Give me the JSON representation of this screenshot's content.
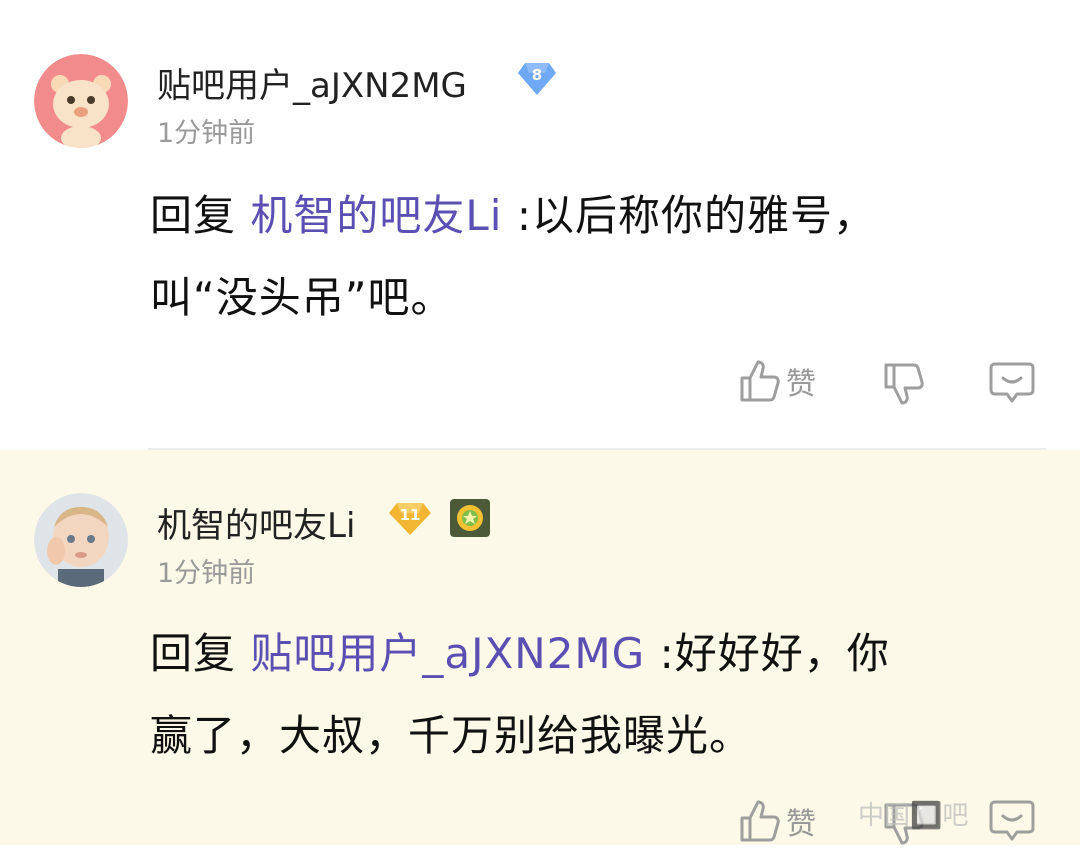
{
  "posts": [
    {
      "username": "贴吧用户_aJXN2MG",
      "level": "8",
      "time": "1分钟前",
      "reply_prefix": "回复",
      "reply_to": "机智的吧友Li",
      "text_line1": ":以后称你的雅号，",
      "text_line2": "叫“没头吊”吧。",
      "like_label": "赞",
      "icons": {
        "like": "thumbs-up-icon",
        "dislike": "thumbs-down-icon",
        "reply": "comment-icon",
        "level": "diamond-badge-icon"
      },
      "level_color": "#6fa8f5"
    },
    {
      "username": "机智的吧友Li",
      "level": "11",
      "time": "1分钟前",
      "reply_prefix": "回复",
      "reply_to": "贴吧用户_aJXN2MG",
      "text_line1": ":好好好，你",
      "text_line2": "赢了，大叔，千万别给我曝光。",
      "like_label": "赞",
      "icons": {
        "like": "thumbs-up-icon",
        "dislike": "thumbs-down-icon",
        "reply": "comment-icon",
        "level": "diamond-badge-icon",
        "medal": "star-medal-icon"
      },
      "level_color": "#f2b632"
    }
  ],
  "watermark": "中国🔲吧",
  "colors": {
    "mention": "#5b4fb3",
    "cream_bg": "#fcf9e8",
    "muted": "#9a9a9a"
  }
}
